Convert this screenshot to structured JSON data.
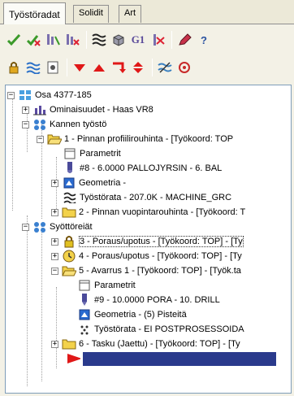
{
  "tabs": [
    {
      "label": "Työstöradat",
      "active": true
    },
    {
      "label": "Solidit",
      "active": false
    },
    {
      "label": "Art",
      "active": false
    }
  ],
  "toolbar1": [
    "verify-check-icon",
    "verify-check-x-icon",
    "toolpath-select-icon",
    "toolpath-delete-icon",
    "toolpath-display-icon",
    "stock-cube-icon",
    "gcode-icon",
    "post-icon",
    "edit-pencil-icon",
    "help-icon"
  ],
  "toolbar1_gcode": "G1",
  "toolbar1_help": "?",
  "toolbar2": [
    "lock-icon",
    "wave-icon",
    "marker-icon",
    "move-down-icon",
    "move-up-icon",
    "insert-icon",
    "sort-icon",
    "backplot-icon",
    "settings-icon"
  ],
  "tree": {
    "root": "Osa 4377-185",
    "properties": "Ominaisuudet - Haas VR8",
    "group1": "Kannen työstö",
    "op1": "1 - Pinnan profiilirouhinta - [Työkoord: TOP",
    "op1_params": "Parametrit",
    "op1_tool": "#8 - 6.0000 PALLOJYRSIN -  6. BAL",
    "op1_geom": "Geometria -",
    "op1_path": "Työstörata - 207.0K - MACHINE_GRC",
    "op2": "2 - Pinnan vuopintarouhinta - [Työkoord: T",
    "group2": "Syöttöreiät",
    "op3": "3 - Poraus/upotus - [Työkoord: TOP] - [Ty",
    "op4": "4 - Poraus/upotus - [Työkoord: TOP] - [Ty",
    "op5": "5 - Avarrus 1 - [Työkoord: TOP] - [Työk.ta",
    "op5_params": "Parametrit",
    "op5_tool": "#9 - 10.0000 PORA -  10. DRILL",
    "op5_geom": "Geometria - (5) Pisteitä",
    "op5_path": "Työstörata - EI POSTPROSESSOIDA",
    "op6": "6 - Tasku (Jaettu) - [Työkoord: TOP] - [Ty"
  },
  "colors": {
    "selection": "#2a3a8c",
    "folder": "#f3d24a",
    "arrow": "#e01818"
  }
}
